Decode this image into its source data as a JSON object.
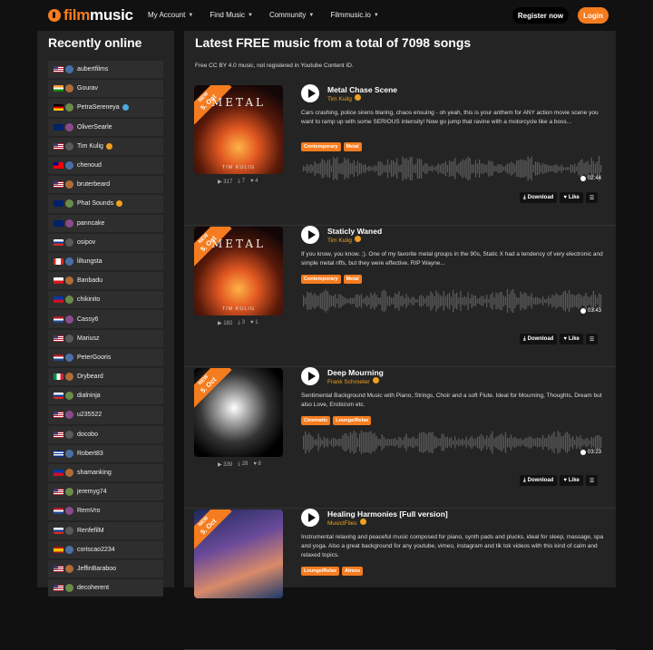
{
  "header": {
    "logo_film": "film",
    "logo_music": "music",
    "nav": [
      {
        "label": "My Account"
      },
      {
        "label": "Find Music"
      },
      {
        "label": "Community"
      },
      {
        "label": "Filmmusic.io"
      }
    ],
    "register_label": "Register now",
    "login_label": "Login"
  },
  "sidebar": {
    "title": "Recently online",
    "users": [
      {
        "name": "aubertfilms",
        "flag": "us"
      },
      {
        "name": "Gourav",
        "flag": "in"
      },
      {
        "name": "PetraSereneya",
        "flag": "de",
        "verified": "blue"
      },
      {
        "name": "OliverSearle",
        "flag": "nz"
      },
      {
        "name": "Tim Kulig",
        "flag": "us",
        "verified": "gold"
      },
      {
        "name": "chenoud",
        "flag": "tw"
      },
      {
        "name": "bruterbeard",
        "flag": "us"
      },
      {
        "name": "Phat Sounds",
        "flag": "gb",
        "verified": "gold"
      },
      {
        "name": "panncake",
        "flag": "au"
      },
      {
        "name": "osipov",
        "flag": "ru"
      },
      {
        "name": "liltungsta",
        "flag": "ca"
      },
      {
        "name": "Banbadu",
        "flag": "cz"
      },
      {
        "name": "chikinito",
        "flag": "ph"
      },
      {
        "name": "Cassy6",
        "flag": "nl"
      },
      {
        "name": "Mariusz",
        "flag": "us"
      },
      {
        "name": "PeterGooris",
        "flag": "nl"
      },
      {
        "name": "Drybeard",
        "flag": "it"
      },
      {
        "name": "dialninja",
        "flag": "ru"
      },
      {
        "name": "u235522",
        "flag": "us"
      },
      {
        "name": "docobo",
        "flag": "us"
      },
      {
        "name": "Robert83",
        "flag": "cu"
      },
      {
        "name": "shamanking",
        "flag": "ph"
      },
      {
        "name": "jeremyg74",
        "flag": "us"
      },
      {
        "name": "RemVro",
        "flag": "nl"
      },
      {
        "name": "RenfefilM",
        "flag": "ru"
      },
      {
        "name": "coriscao2234",
        "flag": "es"
      },
      {
        "name": "JeffinBaraboo",
        "flag": "us"
      },
      {
        "name": "decoherent",
        "flag": "us"
      }
    ]
  },
  "main": {
    "title": "Latest FREE music from a total of 7098 songs",
    "subtitle": "Free CC BY 4.0 music, not registered in Youtube Content ID.",
    "ribbon_new": "NEW",
    "ribbon_date": "5. Oct",
    "download_label": "Download",
    "like_label": "Like",
    "tracks": [
      {
        "title": "Metal Chase Scene",
        "artist": "Tim Kulig",
        "cover_text": "METAL",
        "cover_artist": "TIM KULIG",
        "description": "Cars crashing, police sirens blaring, chaos ensuing - oh yeah, this is your anthem for ANY action movie scene you want to ramp up with some SERIOUS intensity! Now go jump that ravine with a motorcycle like a boss...",
        "tags": [
          "Contemporary",
          "Metal"
        ],
        "plays": "317",
        "downloads": "7",
        "likes": "4",
        "duration": "02:44"
      },
      {
        "title": "Staticly Waned",
        "artist": "Tim Kulig",
        "cover_text": "METAL",
        "cover_artist": "TIM KULIG",
        "description": "If you know, you know. ;). One of my favorite metal groups in the 90s, Static X had a tendency of very electronic and simple metal riffs, but they were effective. RIP Wayne...",
        "tags": [
          "Contemporary",
          "Metal"
        ],
        "plays": "182",
        "downloads": "3",
        "likes": "1",
        "duration": "03:43"
      },
      {
        "title": "Deep Mourning",
        "artist": "Frank Schroeter",
        "cover_text": "",
        "cover_artist": "",
        "description": "Sentimental Background Music with Piano, Strings, Choir and a soft Flute. Ideal for Mourning, Thoughts, Dream but also Love, Eroticism etc.",
        "tags": [
          "Cinematic",
          "Lounge/Relax"
        ],
        "plays": "339",
        "downloads": "28",
        "likes": "8",
        "duration": "03:23"
      },
      {
        "title": "Healing Harmonies [Full version]",
        "artist": "MusictFiles",
        "cover_text": "",
        "cover_artist": "",
        "description": "Instrumental relaxing and peaceful music composed for piano, synth pads and plucks, ideal for sleep, massage, spa and yoga. Also a great background for any youtube, vimeo, instagram and tik tok videos with this kind of calm and relaxed topics.",
        "tags": [
          "Lounge/Relax",
          "Atmos"
        ],
        "plays": "",
        "downloads": "",
        "likes": "",
        "duration": ""
      }
    ]
  },
  "colors": {
    "accent": "#f57c1f",
    "verified_gold": "#f0a020",
    "panel": "#242424",
    "bg": "#111111"
  }
}
